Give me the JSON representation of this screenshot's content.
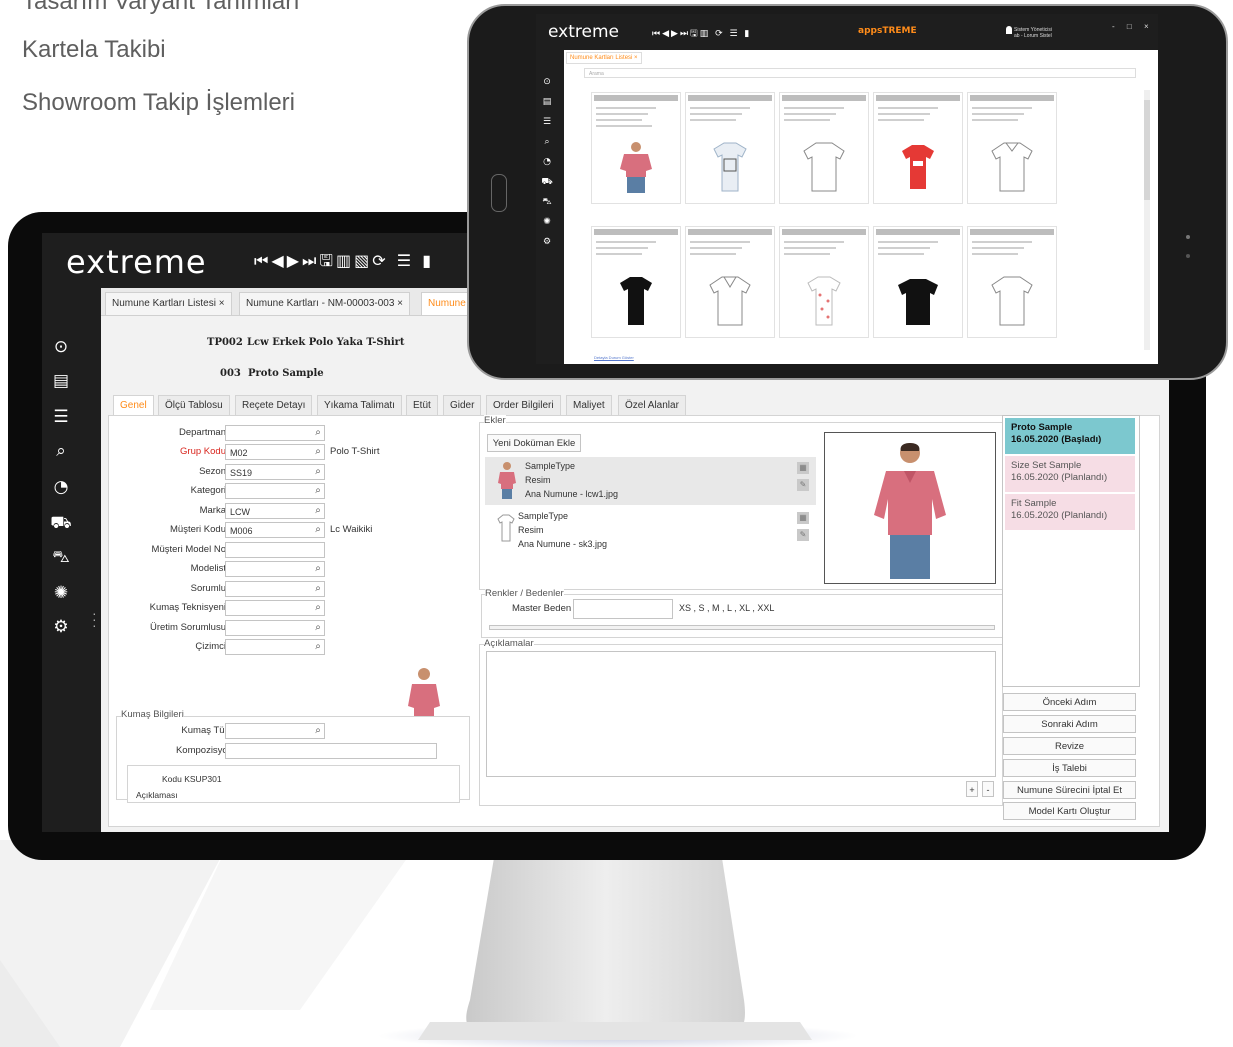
{
  "marketing": {
    "line1": "Tasarım Varyant Tanımları",
    "line2": "Kartela Takibi",
    "line3": "Showroom Takip İşlemleri"
  },
  "desktop": {
    "logo": "extreme",
    "nav_tools": "⏮◀▶⏭🖫▥▧⟳  ☰  ▮",
    "tabs": [
      {
        "label": "Numune Kartları Listesi ×"
      },
      {
        "label": "Numune Kartları - NM-00003-003 ×"
      },
      {
        "label": "Numune"
      }
    ],
    "header": {
      "code": "TP002",
      "name": "Lcw Erkek Polo Yaka T-Shirt",
      "sample_no": "003",
      "sample_name": "Proto Sample"
    },
    "subtabs": [
      "Genel",
      "Ölçü Tablosu",
      "Reçete Detayı",
      "Yıkama Talimatı",
      "Etüt",
      "Gider",
      "Order Bilgileri",
      "Maliyet",
      "Özel Alanlar"
    ],
    "form": {
      "fields": [
        {
          "label": "Departman",
          "value": "",
          "search": true
        },
        {
          "label": "Grup Kodu",
          "value": "M02",
          "search": true
        },
        {
          "label": "Sezon",
          "value": "SS19",
          "search": true
        },
        {
          "label": "Kategori",
          "value": "",
          "search": true
        },
        {
          "label": "Marka",
          "value": "LCW",
          "search": true
        },
        {
          "label": "Müşteri Kodu",
          "value": "M006",
          "search": true
        },
        {
          "label": "Müşteri Model No",
          "value": "",
          "search": false
        },
        {
          "label": "Modelist",
          "value": "",
          "search": true
        },
        {
          "label": "Sorumlu",
          "value": "",
          "search": true
        },
        {
          "label": "Kumaş Teknisyeni",
          "value": "",
          "search": true
        },
        {
          "label": "Üretim Sorumlusu",
          "value": "",
          "search": true
        },
        {
          "label": "Çizimci",
          "value": "",
          "search": true
        }
      ],
      "group_desc": "Polo T-Shirt",
      "customer_desc": "Lc Waikiki"
    },
    "fabric": {
      "title": "Kumaş Bilgileri",
      "type_label": "Kumaş Türü",
      "type_value": "",
      "comp_label": "Kompozisyon",
      "comp_value": "",
      "code_line": "Kodu KSUP301",
      "desc_line": "Açıklaması"
    },
    "attachments": {
      "title": "Ekler",
      "add_button": "Yeni Doküman Ekle",
      "items": [
        {
          "type": "SampleType",
          "kind": "Resim",
          "file": "Ana Numune - lcw1.jpg"
        },
        {
          "type": "SampleType",
          "kind": "Resim",
          "file": "Ana Numune - sk3.jpg"
        }
      ]
    },
    "sizes": {
      "title": "Renkler / Bedenler",
      "master_label": "Master Beden",
      "master_value": "",
      "size_list": "XS , S , M , L , XL , XXL"
    },
    "notes": {
      "title": "Açıklamalar",
      "plus": "+",
      "minus": "-"
    },
    "stages": [
      {
        "name": "Proto Sample",
        "date": "16.05.2020",
        "status": "(Başladı)",
        "color": "#7cc8cf"
      },
      {
        "name": "Size Set Sample",
        "date": "16.05.2020",
        "status": "(Planlandı)",
        "color": "#f6dde5"
      },
      {
        "name": "Fit Sample",
        "date": "16.05.2020",
        "status": "(Planlandı)",
        "color": "#f6dde5"
      }
    ],
    "actions": [
      "Önceki Adım",
      "Sonraki Adım",
      "Revize",
      "İş Talebi",
      "Numune Sürecini İptal Et",
      "Model Kartı Oluştur"
    ]
  },
  "tablet": {
    "logo": "extreme",
    "nav_tools": "⏮◀▶⏭🖫▥ ⟳ ☰ ▮",
    "apps_label": "appsTREME",
    "user_line1": "Sistem Yöneticisi",
    "user_line2": "ab - Lorum Sistel",
    "window_controls": "- □ ×",
    "tab_label": "Numune Kartları Listesi ×",
    "search_placeholder": "Arama",
    "footer_link": "Detayla Durum Göster"
  },
  "colors": {
    "accent": "#ff8c1a",
    "chrome": "#1e1e1e",
    "required_label": "#d9251d",
    "stage_active": "#7cc8cf",
    "stage_planned": "#f6dde5"
  },
  "icons": {
    "sidebar": [
      "dashboard-icon",
      "document-icon",
      "list-icon",
      "search-icon",
      "timer-icon",
      "truck-icon",
      "cart-icon",
      "network-icon",
      "gear-icon"
    ]
  }
}
